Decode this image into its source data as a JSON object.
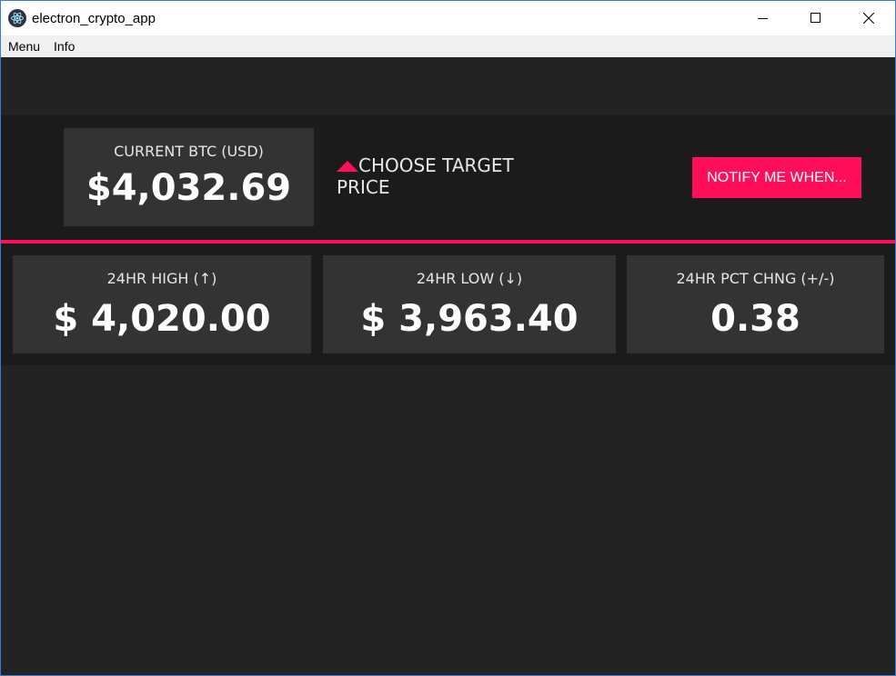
{
  "window": {
    "title": "electron_crypto_app"
  },
  "menubar": {
    "items": [
      "Menu",
      "Info"
    ]
  },
  "current": {
    "label": "CURRENT BTC (USD)",
    "value": "$4,032.69"
  },
  "target": {
    "label": "CHOOSE TARGET PRICE"
  },
  "notify": {
    "label": "NOTIFY ME WHEN..."
  },
  "stats": [
    {
      "label": "24HR HIGH (↑)",
      "value": "$ 4,020.00"
    },
    {
      "label": "24HR LOW (↓)",
      "value": "$ 3,963.40"
    },
    {
      "label": "24HR PCT CHNG (+/-)",
      "value": "0.38"
    }
  ],
  "colors": {
    "accent": "#ff0f5a",
    "background": "#232323",
    "panel": "#333333",
    "band": "#1b1b1b"
  }
}
